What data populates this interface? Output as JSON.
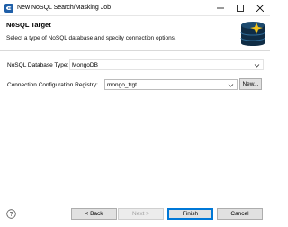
{
  "window": {
    "title": "New NoSQL Search/Masking Job",
    "minimize_glyph": "—",
    "maximize_glyph": "☐",
    "close_glyph": "✕"
  },
  "header": {
    "title": "NoSQL Target",
    "description": "Select a type of NoSQL database and specify connection options."
  },
  "form": {
    "db_type_label": "NoSQL Database Type:",
    "db_type_value": "MongoDB",
    "registry_label": "Connection Configuration Registry:",
    "registry_value": "mongo_trgt",
    "new_button": "New..."
  },
  "footer": {
    "back": "< Back",
    "next": "Next >",
    "finish": "Finish",
    "cancel": "Cancel"
  },
  "colors": {
    "accent": "#0078d7",
    "button_bg": "#e1e1e1",
    "disabled_text": "#a0a0a0"
  }
}
